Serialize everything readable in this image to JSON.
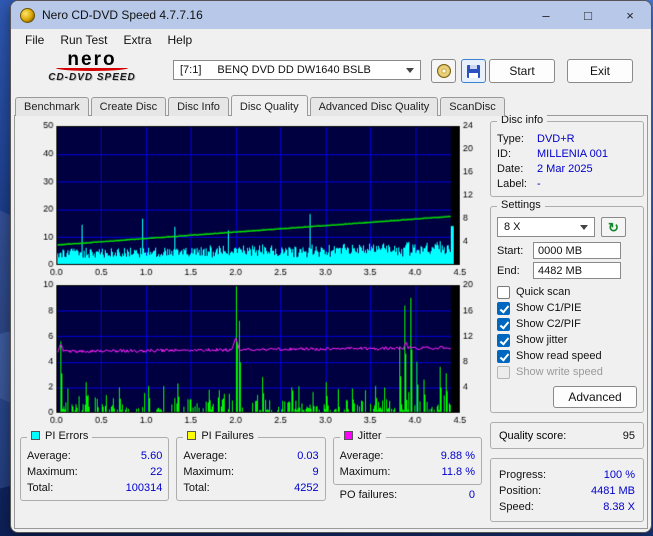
{
  "window": {
    "title": "Nero CD-DVD Speed 4.7.7.16",
    "minimize": "–",
    "maximize": "□",
    "close": "×"
  },
  "menu": {
    "items": [
      "File",
      "Run Test",
      "Extra",
      "Help"
    ]
  },
  "toolbar": {
    "logo_top": "nero",
    "logo_bottom": "CD-DVD SPEED",
    "drive_unit": "[7:1]",
    "drive_name": "BENQ DVD DD DW1640 BSLB",
    "start": "Start",
    "exit": "Exit"
  },
  "tabs": [
    {
      "label": "Benchmark",
      "active": false
    },
    {
      "label": "Create Disc",
      "active": false
    },
    {
      "label": "Disc Info",
      "active": false
    },
    {
      "label": "Disc Quality",
      "active": true
    },
    {
      "label": "Advanced Disc Quality",
      "active": false
    },
    {
      "label": "ScanDisc",
      "active": false
    }
  ],
  "disc_info": {
    "title": "Disc info",
    "type_label": "Type:",
    "type_value": "DVD+R",
    "id_label": "ID:",
    "id_value": "MILLENIA 001",
    "date_label": "Date:",
    "date_value": "2 Mar 2025",
    "label_label": "Label:",
    "label_value": "-"
  },
  "settings": {
    "title": "Settings",
    "speed": "8 X",
    "start_label": "Start:",
    "start_value": "0000 MB",
    "end_label": "End:",
    "end_value": "4482 MB",
    "checkboxes": [
      {
        "label": "Quick scan",
        "checked": false,
        "disabled": false
      },
      {
        "label": "Show C1/PIE",
        "checked": true,
        "disabled": false
      },
      {
        "label": "Show C2/PIF",
        "checked": true,
        "disabled": false
      },
      {
        "label": "Show jitter",
        "checked": true,
        "disabled": false
      },
      {
        "label": "Show read speed",
        "checked": true,
        "disabled": false
      },
      {
        "label": "Show write speed",
        "checked": false,
        "disabled": true
      }
    ],
    "advanced": "Advanced"
  },
  "quality": {
    "label": "Quality score:",
    "value": "95"
  },
  "status": {
    "progress_label": "Progress:",
    "progress_value": "100 %",
    "position_label": "Position:",
    "position_value": "4481 MB",
    "speed_label": "Speed:",
    "speed_value": "8.38 X"
  },
  "stats": {
    "pi_errors": {
      "title": "PI Errors",
      "color": "#00ffff",
      "avg_label": "Average:",
      "avg": "5.60",
      "max_label": "Maximum:",
      "max": "22",
      "total_label": "Total:",
      "total": "100314"
    },
    "pi_failures": {
      "title": "PI Failures",
      "color": "#ffff00",
      "avg_label": "Average:",
      "avg": "0.03",
      "max_label": "Maximum:",
      "max": "9",
      "total_label": "Total:",
      "total": "4252"
    },
    "jitter": {
      "title": "Jitter",
      "color": "#ff00ff",
      "avg_label": "Average:",
      "avg": "9.88 %",
      "max_label": "Maximum:",
      "max": "11.8 %",
      "po_label": "PO failures:",
      "po_value": "0"
    }
  },
  "chart_data": [
    {
      "type": "area",
      "name": "PI Errors and read speed vs disc position (GB)",
      "x_ticks": [
        "0.0",
        "0.5",
        "1.0",
        "1.5",
        "2.0",
        "2.5",
        "3.0",
        "3.5",
        "4.0",
        "4.5"
      ],
      "x_max": 4.5,
      "x_end": 4.4,
      "left_ticks": [
        0,
        10,
        20,
        30,
        40,
        50
      ],
      "left_max": 50,
      "right_ticks": [
        4,
        8,
        12,
        16,
        20,
        24
      ],
      "right_max": 24,
      "bg": "#000041",
      "grid": "#0000d2",
      "end_fill": "#000000",
      "seed": 20250302,
      "series": [
        {
          "name": "PI Errors",
          "style": "noise-area",
          "color": "#00ffff",
          "base": 2.5,
          "rand": 3.5,
          "trend": 3.0,
          "spike_chance": 0.03,
          "spike_amp": 13,
          "max": 22,
          "average": 5.6
        },
        {
          "name": "Read speed",
          "style": "line",
          "axis": "right",
          "color": "#00dd00",
          "start": 3.45,
          "end": 8.38,
          "noise": 0.08
        }
      ],
      "end_bar": {
        "color": "#00ffff",
        "height_frac": 0.28,
        "width": 3
      }
    },
    {
      "type": "spikes",
      "name": "PI Failures and jitter vs disc position (GB)",
      "x_ticks": [
        "0.0",
        "0.5",
        "1.0",
        "1.5",
        "2.0",
        "2.5",
        "3.0",
        "3.5",
        "4.0",
        "4.5"
      ],
      "x_max": 4.5,
      "x_end": 4.4,
      "left_ticks": [
        0,
        2,
        4,
        6,
        8,
        10
      ],
      "left_max": 10,
      "right_ticks": [
        4,
        8,
        12,
        16,
        20
      ],
      "right_max": 20,
      "bg": "#000041",
      "grid": "#0000d2",
      "end_fill": "#000000",
      "seed": 4252,
      "series": [
        {
          "name": "PI Failures",
          "style": "spikes",
          "color": "#00ee00",
          "density": 0.45,
          "small_max": 2.0,
          "average": 0.03,
          "maximum": 9,
          "spikes": [
            [
              0.05,
              5.6
            ],
            [
              0.33,
              2.4
            ],
            [
              0.7,
              2.0
            ],
            [
              1.02,
              2.1
            ],
            [
              1.35,
              2.3
            ],
            [
              1.7,
              1.8
            ],
            [
              2.0,
              9.9
            ],
            [
              2.04,
              7.2
            ],
            [
              2.3,
              2.8
            ],
            [
              2.62,
              2.0
            ],
            [
              3.0,
              2.4
            ],
            [
              3.3,
              1.9
            ],
            [
              3.55,
              2.1
            ],
            [
              3.82,
              5.2
            ],
            [
              3.88,
              8.4
            ],
            [
              3.95,
              9.0
            ],
            [
              4.02,
              4.0
            ],
            [
              4.1,
              2.6
            ],
            [
              4.28,
              3.6
            ],
            [
              4.34,
              3.1
            ]
          ]
        },
        {
          "name": "Jitter",
          "style": "noise-line",
          "axis": "right",
          "color": "#ff22ff",
          "level_start": 9.6,
          "level_end": 10.2,
          "noise": 0.25,
          "average": 9.88,
          "maximum": 11.8,
          "spikes": [
            [
              0.05,
              10.9
            ],
            [
              2.0,
              11.8
            ],
            [
              3.9,
              11.2
            ]
          ]
        }
      ]
    }
  ]
}
